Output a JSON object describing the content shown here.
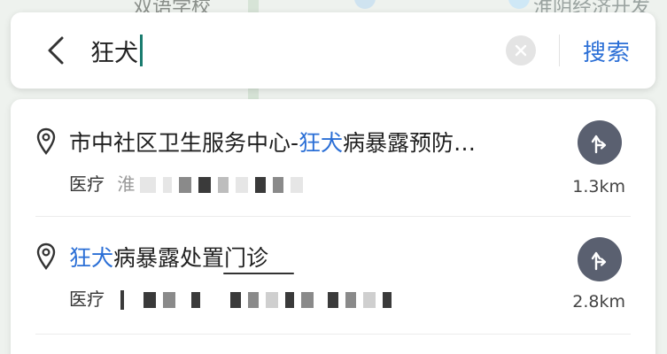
{
  "map": {
    "label_left": "双语学校",
    "label_right": "淮阴经济开发"
  },
  "search": {
    "query": "狂犬",
    "search_label": "搜索"
  },
  "results": [
    {
      "title_prefix": "市中社区卫生服务中心-",
      "title_highlight": "狂犬",
      "title_suffix": "病暴露预防…",
      "category": "医疗",
      "category_extra": "淮",
      "distance": "1.3km"
    },
    {
      "title_prefix": "",
      "title_highlight": "狂犬",
      "title_suffix": "病暴露处置门诊",
      "category": "医疗",
      "category_extra": "",
      "distance": "2.8km"
    }
  ],
  "colors": {
    "accent": "#2b6fd6",
    "route_button": "#5a6070",
    "caret": "#1a7c6f"
  },
  "icons": {
    "back": "chevron-left-icon",
    "clear": "close-icon",
    "pin": "location-pin-icon",
    "route": "route-arrow-icon"
  }
}
